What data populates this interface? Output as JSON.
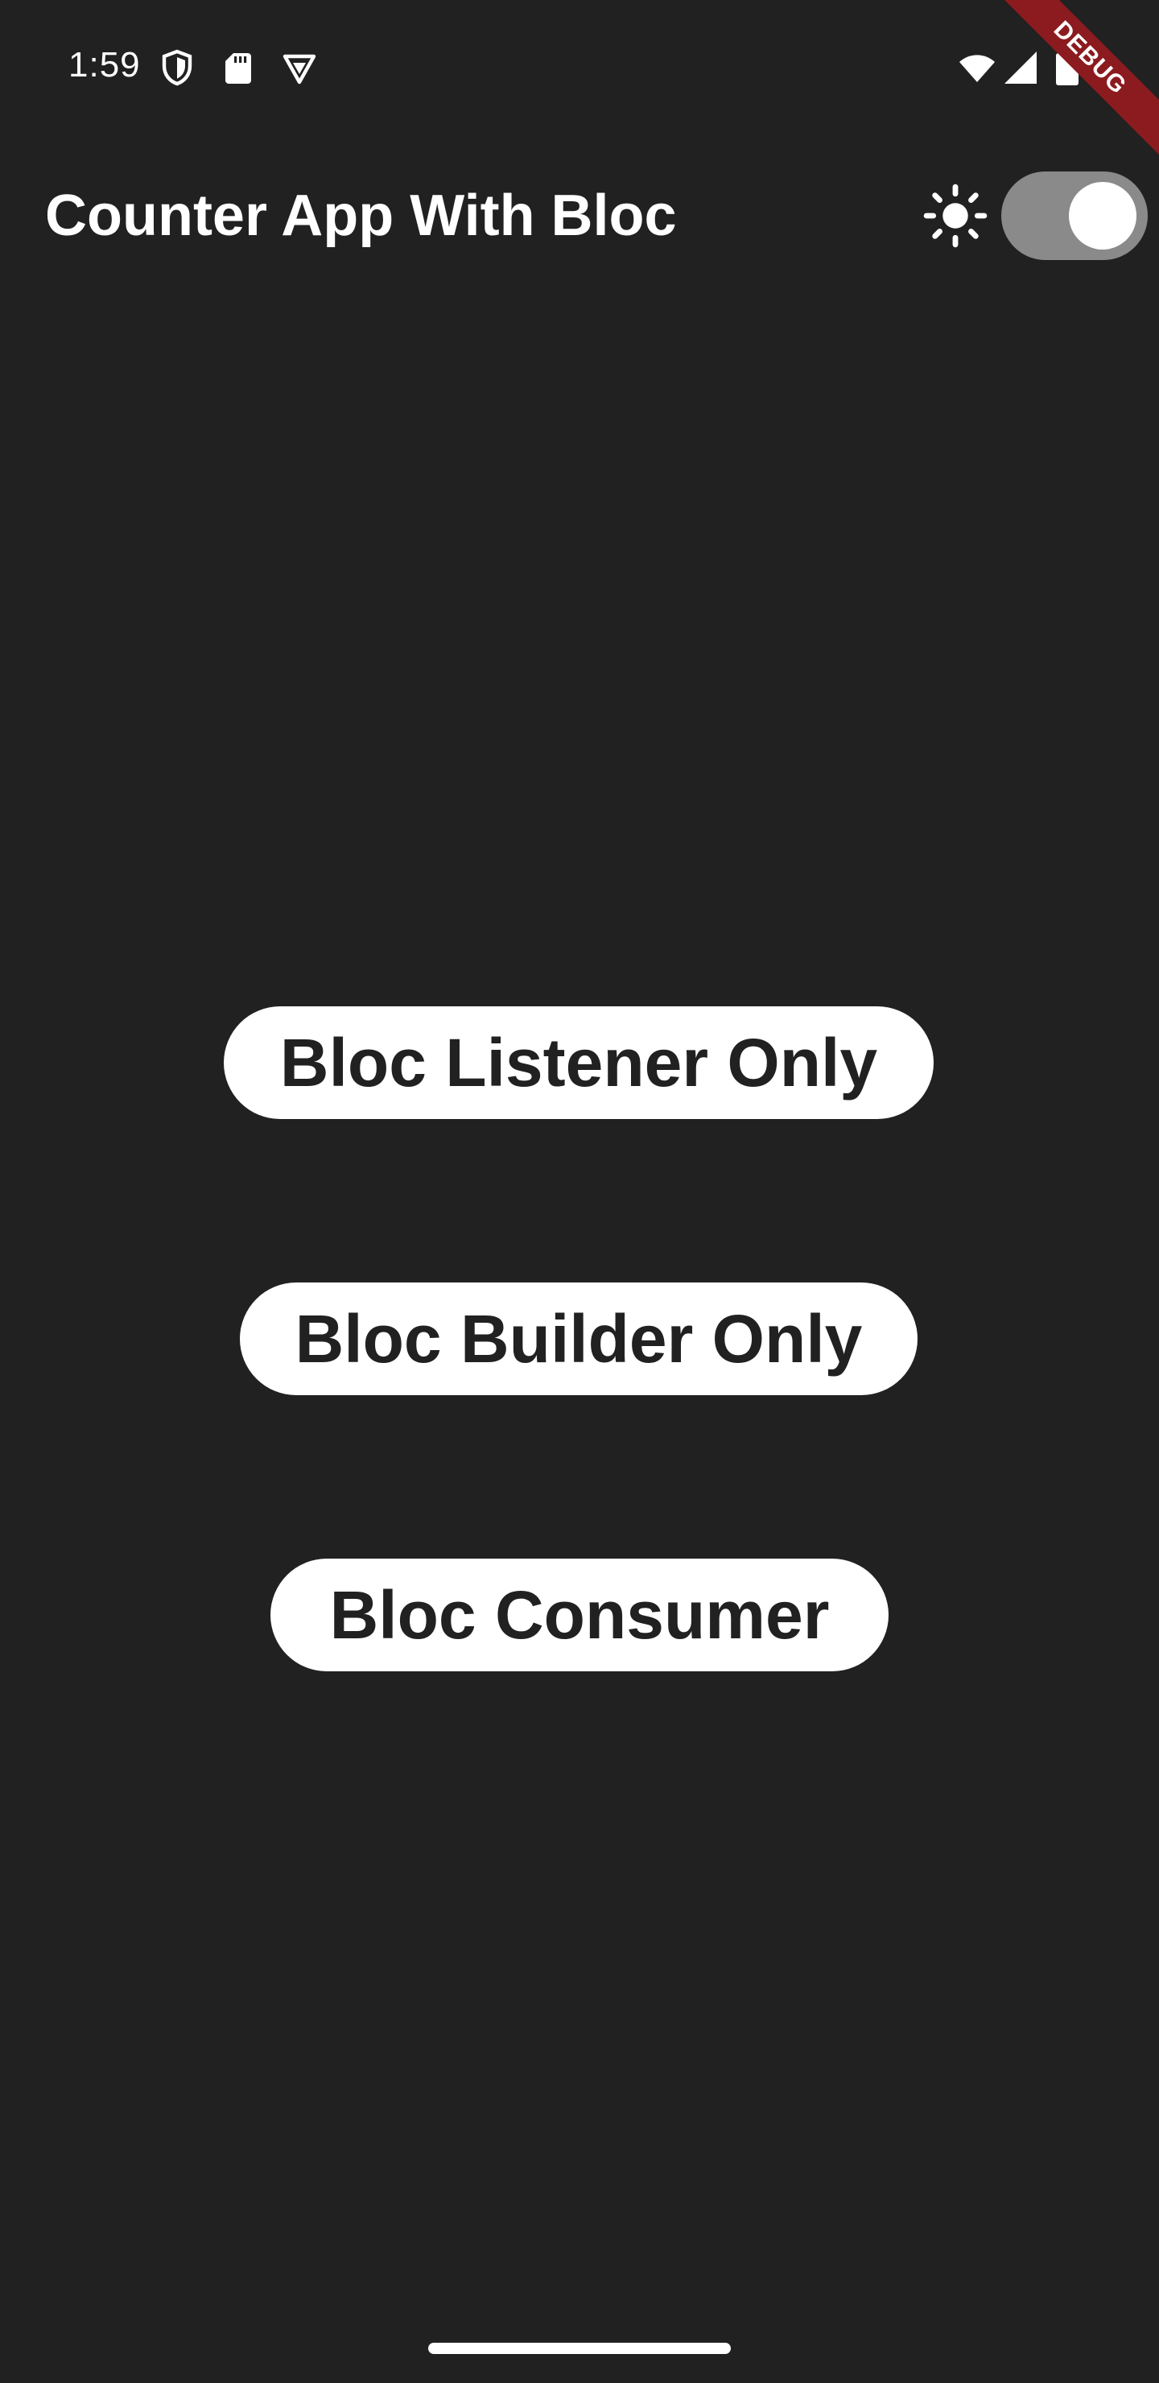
{
  "status_bar": {
    "time": "1:59",
    "left_icons": [
      "shield-icon",
      "sd-card-icon",
      "vpn-icon"
    ],
    "right_icons": [
      "wifi-icon",
      "signal-icon",
      "battery-icon"
    ]
  },
  "debug_banner": {
    "label": "DEBUG",
    "color": "#8b1b1f"
  },
  "app_bar": {
    "title": "Counter App With Bloc",
    "theme_icon": "sun-icon",
    "theme_toggle_on": true
  },
  "buttons": {
    "listener_label": "Bloc Listener Only",
    "builder_label": "Bloc Builder Only",
    "consumer_label": "Bloc Consumer"
  },
  "colors": {
    "background": "#212121",
    "button_bg": "#ffffff",
    "button_text": "#212121",
    "toggle_track": "#8a8a8a"
  }
}
